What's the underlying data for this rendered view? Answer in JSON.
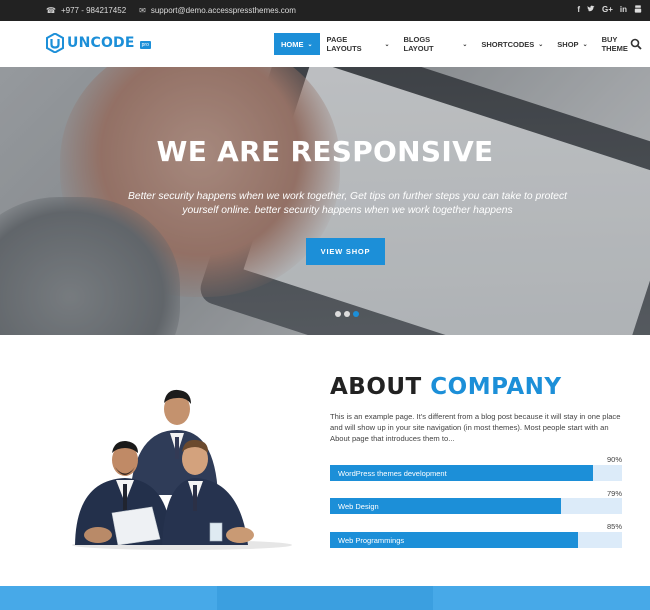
{
  "topbar": {
    "phone": "+977 - 984217452",
    "email": "support@demo.accesspressthemes.com",
    "social": [
      "f",
      "t",
      "G+",
      "in",
      "yt"
    ]
  },
  "brand": {
    "name": "UNCODE",
    "badge": "pro",
    "color": "#1c8fd8"
  },
  "nav": {
    "items": [
      {
        "label": "HOME"
      },
      {
        "label": "PAGE LAYOUTS"
      },
      {
        "label": "BLOGS LAYOUT"
      },
      {
        "label": "SHORTCODES"
      },
      {
        "label": "SHOP"
      },
      {
        "label": "BUY THEME"
      }
    ]
  },
  "hero": {
    "title": "WE ARE RESPONSIVE",
    "subtitle": "Better security happens when we work together, Get tips on further steps you can take to protect yourself online. better security happens when we work together happens",
    "button": "VIEW SHOP",
    "slides": 3,
    "active_slide": 3
  },
  "about": {
    "title_part1": "ABOUT",
    "title_part2": "COMPANY",
    "text": "This is an example page. It's different from a blog post because it will stay in one place and will show up in your site navigation (in most themes). Most people start with an About page that introduces them to...",
    "skills": [
      {
        "label": "WordPress themes development",
        "percent_text": "90%",
        "value": 90
      },
      {
        "label": "Web Design",
        "percent_text": "79%",
        "value": 79
      },
      {
        "label": "Web Programmings",
        "percent_text": "85%",
        "value": 85
      }
    ]
  },
  "colors": {
    "accent": "#1c8fd8",
    "topbar": "#222222",
    "band": [
      "#47a9e8",
      "#3b9fe0",
      "#47a9e8"
    ]
  }
}
